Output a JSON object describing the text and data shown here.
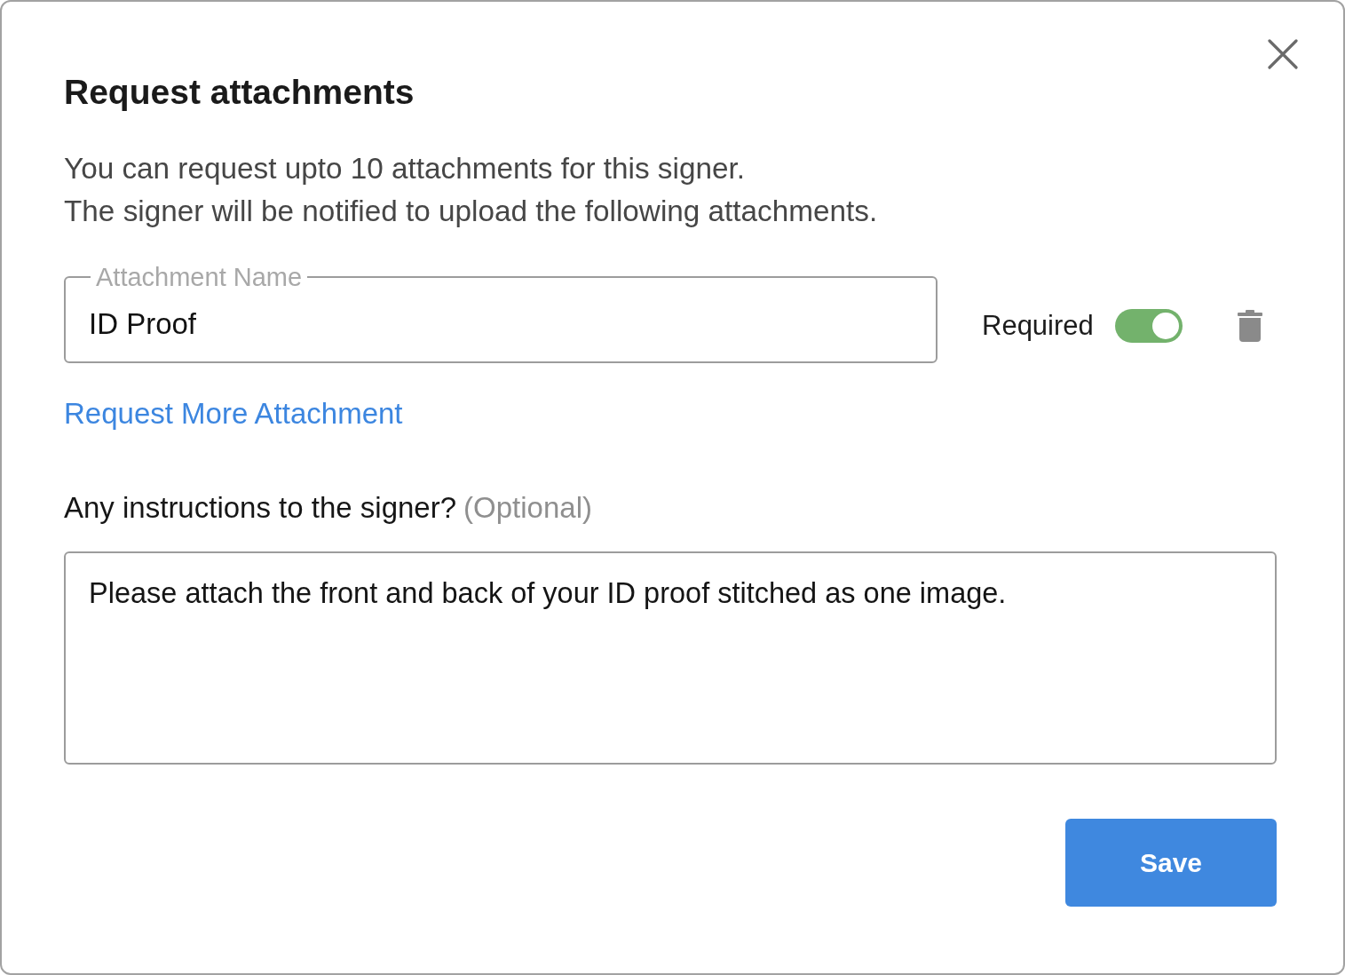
{
  "dialog": {
    "title": "Request attachments",
    "description": [
      "You can request upto 10 attachments for this signer.",
      "The signer will be notified to upload the following attachments."
    ],
    "attachments": [
      {
        "label": "Attachment Name",
        "value": "ID Proof",
        "required_label": "Required",
        "required": true
      }
    ],
    "add_link": "Request More Attachment",
    "instructions": {
      "label": "Any instructions to the signer?",
      "hint": "(Optional)",
      "value": "Please attach the front and back of your ID proof stitched as one image."
    },
    "buttons": [
      {
        "label": "Save",
        "kind": "primary"
      }
    ]
  }
}
